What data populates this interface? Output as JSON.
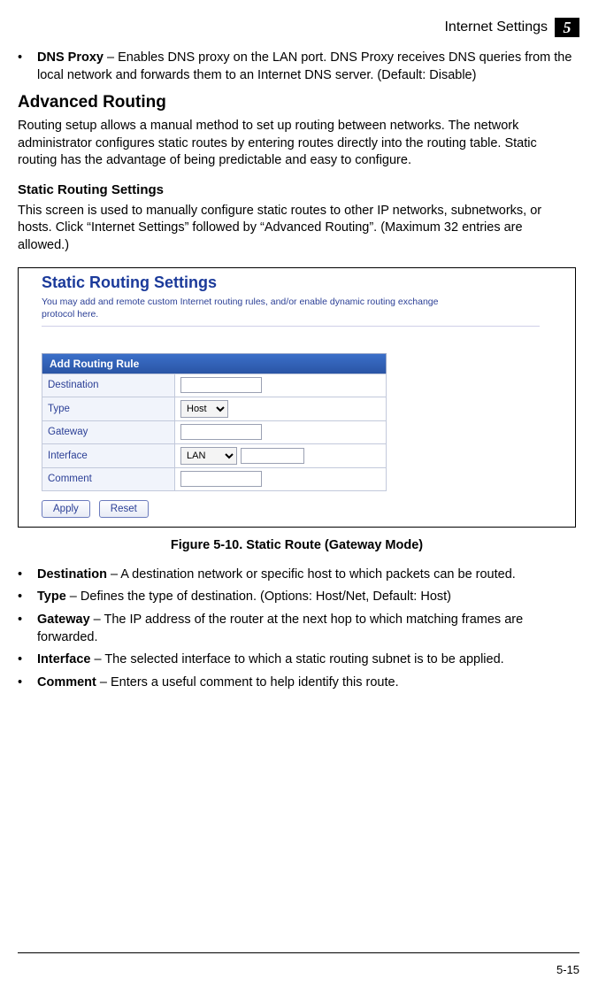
{
  "header": {
    "title": "Internet Settings",
    "chapter": "5"
  },
  "dns_bullet": {
    "term": "DNS Proxy",
    "text": " – Enables DNS proxy on the LAN port. DNS Proxy receives DNS queries from the local network and forwards them to an Internet DNS server. (Default: Disable)"
  },
  "section": {
    "title": "Advanced Routing",
    "para": "Routing setup allows a manual method to set up routing between networks. The network administrator configures static routes by entering routes directly into the routing table. Static routing has the advantage of being predictable and easy to configure."
  },
  "subsection": {
    "title": "Static Routing Settings",
    "para": "This screen is used to manually configure static routes to other IP networks, subnetworks, or hosts. Click “Internet Settings” followed by “Advanced Routing”. (Maximum 32 entries are allowed.)"
  },
  "figure": {
    "title": "Static Routing Settings",
    "desc": "You may add and remote custom Internet routing rules, and/or enable dynamic routing exchange protocol here.",
    "panel_header": "Add Routing Rule",
    "rows": {
      "destination": {
        "label": "Destination",
        "value": ""
      },
      "type": {
        "label": "Type",
        "selected": "Host"
      },
      "gateway": {
        "label": "Gateway",
        "value": ""
      },
      "interface": {
        "label": "Interface",
        "selected": "LAN",
        "extra": ""
      },
      "comment": {
        "label": "Comment",
        "value": ""
      }
    },
    "buttons": {
      "apply": "Apply",
      "reset": "Reset"
    },
    "caption": "Figure 5-10.   Static Route (Gateway Mode)"
  },
  "bullets": [
    {
      "term": "Destination",
      "text": " – A destination network or specific host to which packets can be routed."
    },
    {
      "term": "Type",
      "text": " – Defines the type of destination. (Options: Host/Net, Default: Host)"
    },
    {
      "term": "Gateway",
      "text": " – The IP address of the router at the next hop to which matching frames are forwarded."
    },
    {
      "term": "Interface",
      "text": " – The selected interface to which a static routing subnet is to be applied."
    },
    {
      "term": "Comment",
      "text": " – Enters a useful comment to help identify this route."
    }
  ],
  "page_number": "5-15",
  "bullet_char": "•"
}
